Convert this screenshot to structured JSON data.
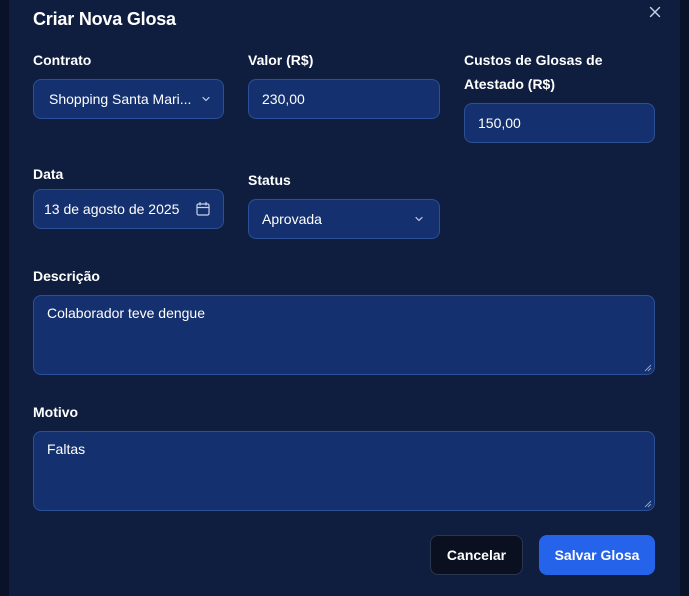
{
  "dialog": {
    "title": "Criar Nova Glosa"
  },
  "form": {
    "contrato": {
      "label": "Contrato",
      "value": "Shopping Santa Mari..."
    },
    "valor": {
      "label": "Valor (R$)",
      "value": "230,00"
    },
    "custos": {
      "label_line1": "Custos de Glosas de",
      "label_line2": "Atestado (R$)",
      "value": "150,00"
    },
    "data": {
      "label": "Data",
      "value": "13 de agosto de 2025"
    },
    "status": {
      "label": "Status",
      "value": "Aprovada"
    },
    "descricao": {
      "label": "Descrição",
      "value": "Colaborador teve dengue"
    },
    "motivo": {
      "label": "Motivo",
      "value": "Faltas"
    }
  },
  "actions": {
    "cancel_label": "Cancelar",
    "save_label": "Salvar Glosa"
  },
  "icons": {
    "close": "close-icon",
    "chevron": "chevron-down-icon",
    "calendar": "calendar-icon"
  },
  "colors": {
    "modal_bg": "#0f1d3f",
    "field_bg": "#14306e",
    "field_border": "#2c4f96",
    "primary": "#2563eb",
    "cancel_bg": "#0b1020"
  }
}
